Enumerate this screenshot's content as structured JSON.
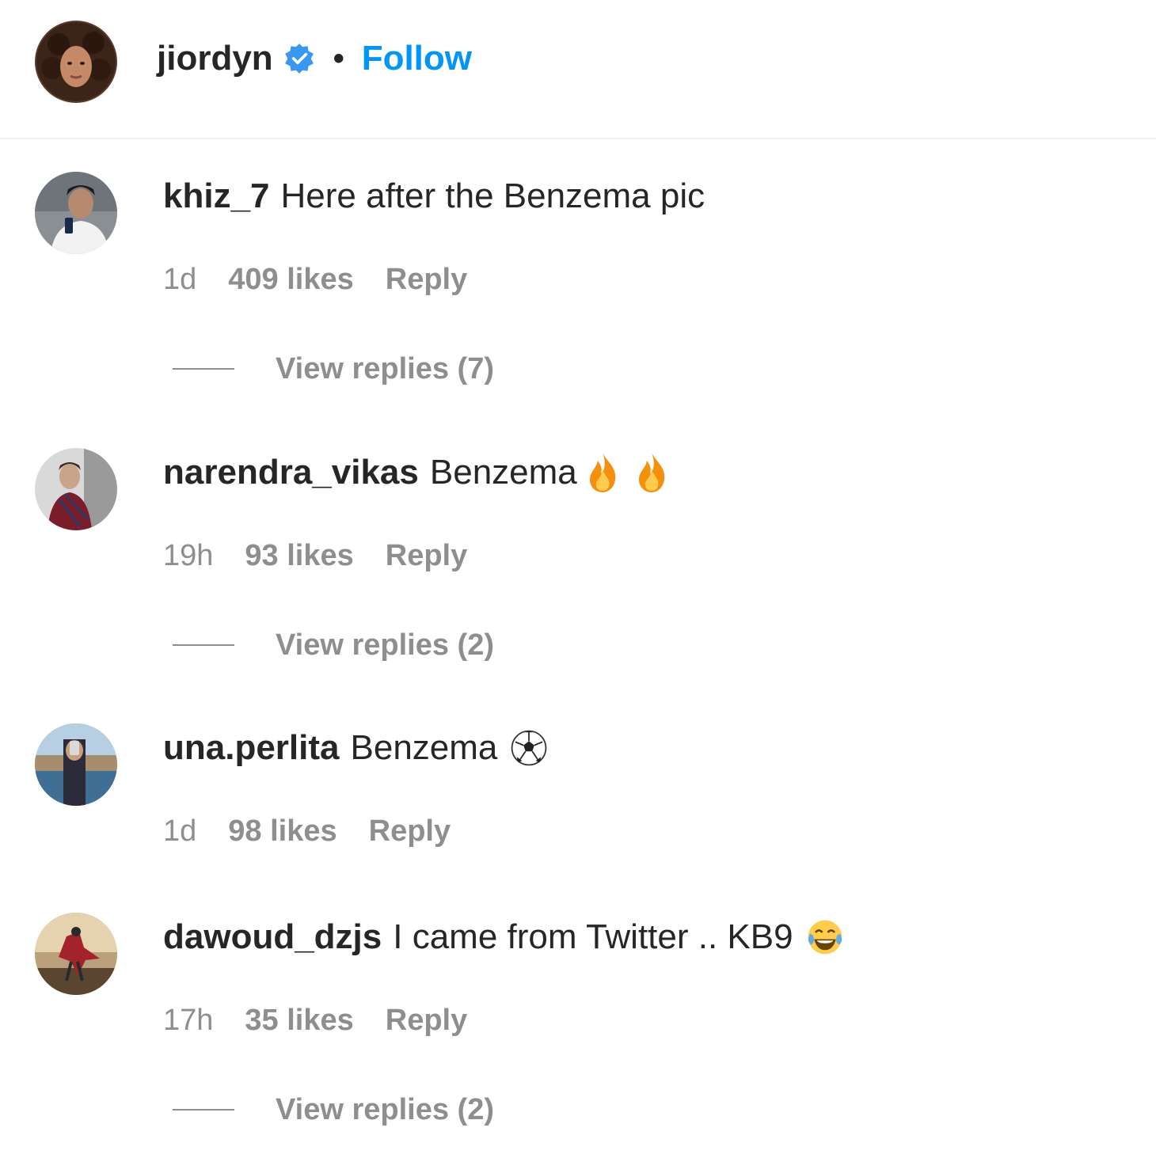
{
  "colors": {
    "accent": "#0095f6",
    "text": "#262626",
    "secondary": "#8e8e8e",
    "divider": "#efefef"
  },
  "post_header": {
    "username": "jiordyn",
    "verified_icon": "verified-badge-icon",
    "separator": "•",
    "follow_label": "Follow"
  },
  "comments": [
    {
      "username": "khiz_7",
      "text": "Here after the Benzema pic",
      "emojis": [],
      "time": "1d",
      "likes": "409 likes",
      "reply_label": "Reply",
      "view_replies": "View replies (7)"
    },
    {
      "username": "narendra_vikas",
      "text": "Benzema",
      "emojis": [
        "fire-emoji",
        "fire-emoji"
      ],
      "time": "19h",
      "likes": "93 likes",
      "reply_label": "Reply",
      "view_replies": "View replies (2)"
    },
    {
      "username": "una.perlita",
      "text": "Benzema",
      "emojis": [
        "soccer-ball-emoji"
      ],
      "time": "1d",
      "likes": "98 likes",
      "reply_label": "Reply",
      "view_replies": null
    },
    {
      "username": "dawoud_dzjs",
      "text": "I came from Twitter .. KB9",
      "emojis": [
        "tears-of-joy-emoji"
      ],
      "time": "17h",
      "likes": "35 likes",
      "reply_label": "Reply",
      "view_replies": "View replies (2)"
    }
  ]
}
